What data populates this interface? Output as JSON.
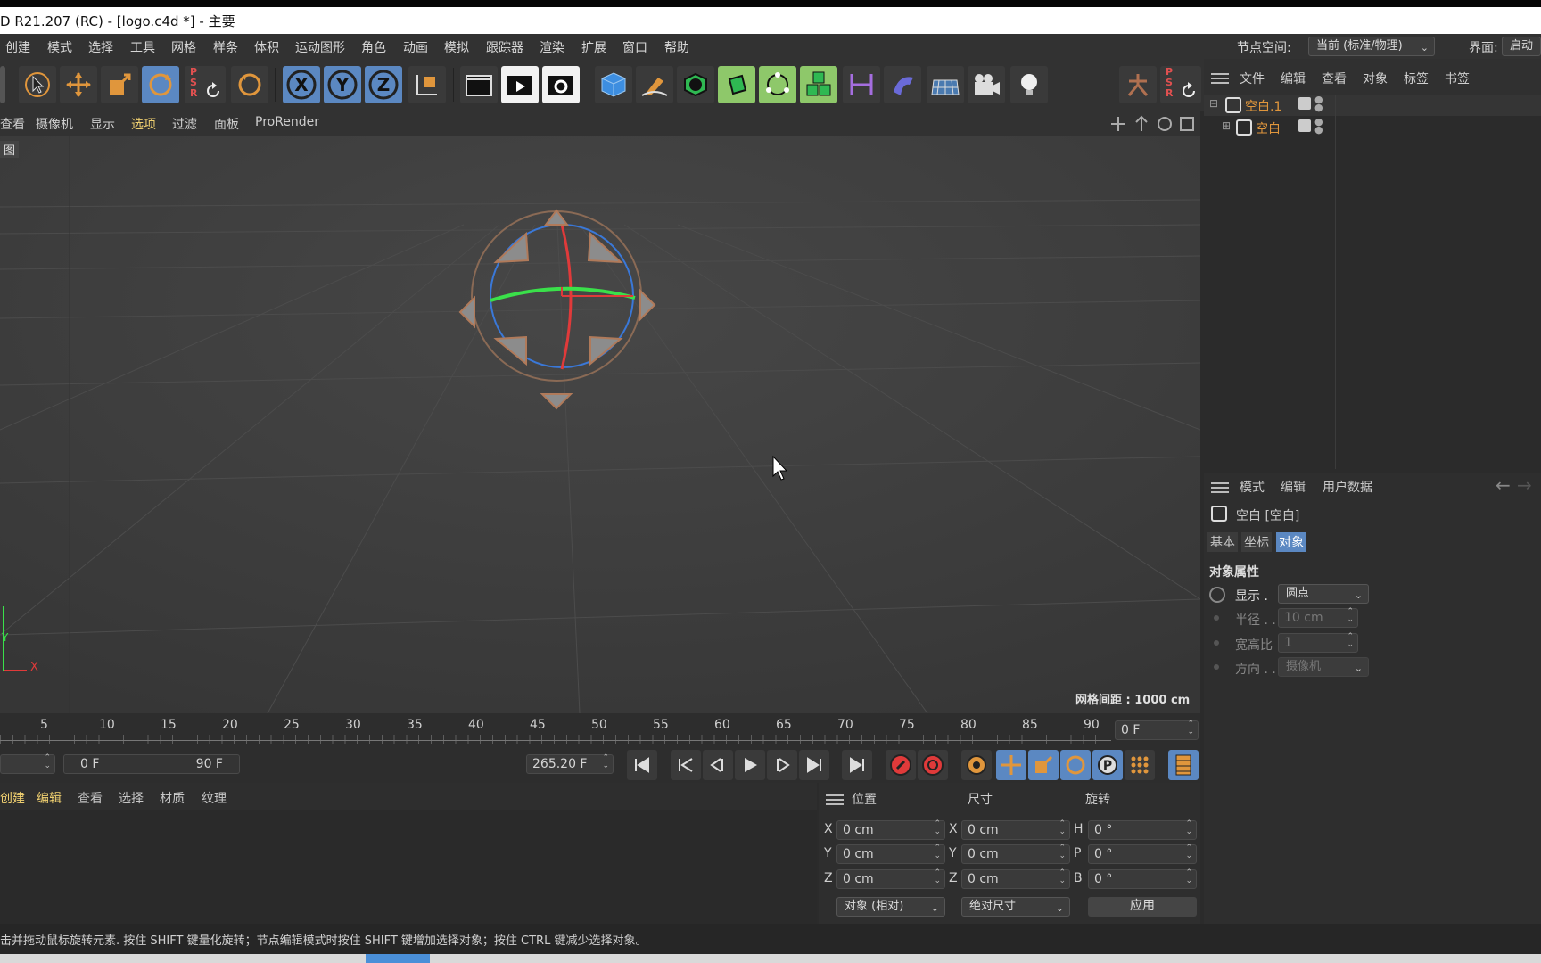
{
  "window": {
    "title": "D R21.207 (RC) - [logo.c4d *] - 主要"
  },
  "menubar": {
    "items": [
      "创建",
      "模式",
      "选择",
      "工具",
      "网格",
      "样条",
      "体积",
      "运动图形",
      "角色",
      "动画",
      "模拟",
      "跟踪器",
      "渲染",
      "扩展",
      "窗口",
      "帮助"
    ],
    "node_space_label": "节点空间:",
    "node_space_value": "当前 (标准/物理)",
    "layout_label": "界面:",
    "layout_value": "启动"
  },
  "toolbar": {
    "icons": [
      "select-arrow-icon",
      "move-icon",
      "scale-icon",
      "rotate-icon",
      "psr-reset-icon",
      "recent-tool-icon",
      "axis-x-icon",
      "axis-y-icon",
      "axis-z-icon",
      "coordinate-system-icon",
      "render-region-icon",
      "render-view-icon",
      "render-settings-icon",
      "cube-icon",
      "pen-icon",
      "subdivision-icon",
      "extrude-icon",
      "cloner-icon",
      "mograph-icon",
      "deformer-icon",
      "bend-icon",
      "floor-icon",
      "camera-icon",
      "light-icon"
    ],
    "psr_letters": [
      "P",
      "S",
      "R"
    ],
    "accent_blue": "#5b88c2",
    "accent_green": "#8ec86a"
  },
  "viewport_menu": {
    "items": [
      "查看",
      "摄像机",
      "显示",
      "选项",
      "过滤",
      "面板",
      "ProRender"
    ],
    "corner_label": "图",
    "grid_label": "网格间距 : 1000 cm",
    "axis_y": "Y",
    "axis_x": "X"
  },
  "object_manager": {
    "menu": [
      "文件",
      "编辑",
      "查看",
      "对象",
      "标签",
      "书签"
    ],
    "objects": [
      {
        "name": "空白.1",
        "color": "#e0963c"
      },
      {
        "name": "空白",
        "color": "#e0963c"
      }
    ]
  },
  "attributes": {
    "menu": [
      "模式",
      "编辑",
      "用户数据"
    ],
    "object_title": "空白 [空白]",
    "tabs": [
      "基本",
      "坐标",
      "对象"
    ],
    "active_tab": "对象",
    "section": "对象属性",
    "fields": [
      {
        "label": "显示 .",
        "value": "圆点",
        "type": "select",
        "enabled": true
      },
      {
        "label": "半径 . .",
        "value": "10 cm",
        "type": "number",
        "enabled": false
      },
      {
        "label": "宽高比",
        "value": "1",
        "type": "number",
        "enabled": false
      },
      {
        "label": "方向 . .",
        "value": "摄像机",
        "type": "select",
        "enabled": false
      }
    ]
  },
  "timeline": {
    "ticks": [
      "5",
      "10",
      "15",
      "20",
      "25",
      "30",
      "35",
      "40",
      "45",
      "50",
      "55",
      "60",
      "65",
      "70",
      "75",
      "80",
      "85",
      "90"
    ],
    "current_frame": "0 F",
    "range_start": "0 F",
    "range_end": "90 F",
    "fps_value": "265.20 F"
  },
  "material_menu": {
    "items": [
      "创建",
      "编辑",
      "查看",
      "选择",
      "材质",
      "纹理"
    ]
  },
  "coordinates": {
    "headers": [
      "位置",
      "尺寸",
      "旋转"
    ],
    "position": [
      {
        "axis": "X",
        "value": "0 cm"
      },
      {
        "axis": "Y",
        "value": "0 cm"
      },
      {
        "axis": "Z",
        "value": "0 cm"
      }
    ],
    "size": [
      {
        "axis": "X",
        "value": "0 cm"
      },
      {
        "axis": "Y",
        "value": "0 cm"
      },
      {
        "axis": "Z",
        "value": "0 cm"
      }
    ],
    "rotation": [
      {
        "axis": "H",
        "value": "0 °"
      },
      {
        "axis": "P",
        "value": "0 °"
      },
      {
        "axis": "B",
        "value": "0 °"
      }
    ],
    "mode_select": "对象 (相对)",
    "size_select": "绝对尺寸",
    "apply_label": "应用"
  },
  "status": {
    "text": "击并拖动鼠标旋转元素. 按住 SHIFT 键量化旋转；节点编辑模式时按住 SHIFT 键增加选择对象；按住 CTRL 键减少选择对象。"
  }
}
